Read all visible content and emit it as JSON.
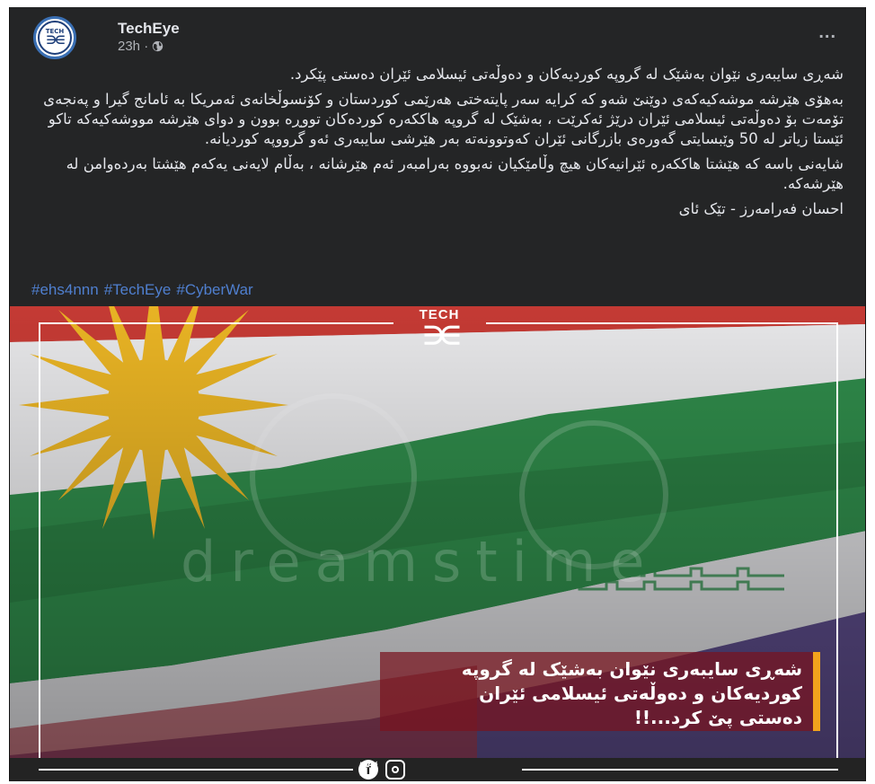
{
  "post": {
    "page_name": "TechEye",
    "timestamp": "23h ·",
    "privacy_icon": "globe-icon",
    "more_label": "...",
    "avatar": {
      "top_text": "TECH",
      "mark": "∋∈"
    },
    "paragraphs": [
      "شەڕی سایبەری نێوان بەشێک لە گروپە کوردیەکان و دەوڵەتی ئیسلامی ئێران دەستی پێکرد.",
      "بەهۆی هێرشە موشەکیەکەی دوێنێ شەو کە کرایە سەر پایتەختی هەرێمی کوردستان و کۆنسوڵخانەی ئەمریکا بە ئامانج گیرا و پەنجەی تۆمەت بۆ دەوڵەتی ئیسلامی ئێران درێژ ئەکرێت ، بەشێک لە گروپە هاککەرە کوردەکان تووڕە بوون و دوای هێرشە مووشەکیەکە تاکو ئێستا زیاتر لە 50 وێبسایتی گەورەی بازرگانی ئێران کەوتوونەتە بەر هێرشی سایبەری ئەو گرووپە کوردیانە.",
      "شایەنی باسە کە هێشتا هاککەرە ئێرانیەکان هیچ وڵامێکیان نەبووە بەرامبەر ئەم هێرشانە ، بەڵام لایەنی یەکەم هێشتا بەردەوامن لە هێرشەکە.",
      "احسان فەرامەرز - تێک ئای"
    ],
    "hashtags": [
      "#ehs4nnn",
      "#TechEye",
      "#CyberWar"
    ]
  },
  "image": {
    "brand_top": "TECH",
    "brand_mark": "∋∈",
    "watermark": "dreamstime",
    "caption_lines": [
      "شەڕی سایبەری نێوان بەشێک لە گروپە",
      "کوردیەکان و دەوڵەتی ئیسلامی ئێران",
      "دەستی پێ کرد...!!"
    ],
    "social": {
      "facebook": "f",
      "instagram": "instagram-icon",
      "twitter": "twitter-icon"
    }
  },
  "colors": {
    "card_bg": "#242526",
    "text": "#e4e6eb",
    "muted": "#b0b3b8",
    "hashtag": "#4f7fcf",
    "flag_red": "#c43a34",
    "flag_white": "#e8e8e8",
    "flag_green": "#2f8a4a",
    "sun_yellow": "#e8b324",
    "caption_accent": "#f2a31d"
  }
}
